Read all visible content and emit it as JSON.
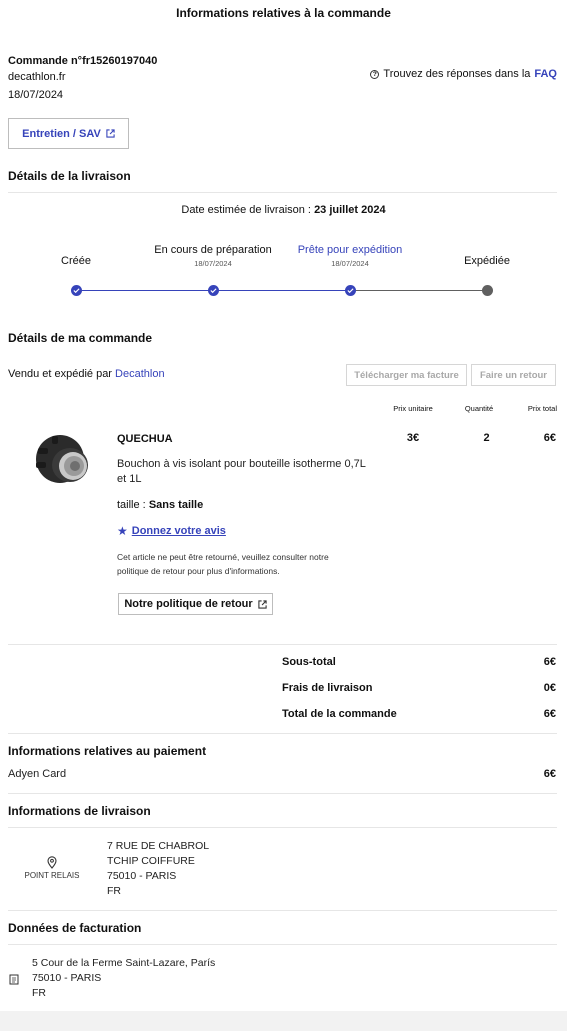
{
  "page": {
    "title": "Informations relatives à la commande"
  },
  "order": {
    "number_label": "Commande n°fr15260197040",
    "site": "decathlon.fr",
    "date": "18/07/2024"
  },
  "faq": {
    "prefix": "Trouvez des réponses dans la",
    "link": "FAQ"
  },
  "service_button": "Entretien / SAV",
  "delivery": {
    "heading": "Détails de la livraison",
    "estimate_prefix": "Date estimée de livraison :",
    "estimate_date": "23 juillet 2024",
    "steps": [
      {
        "label": "Créée",
        "date": "",
        "status": "done"
      },
      {
        "label": "En cours de préparation",
        "date": "18/07/2024",
        "status": "done"
      },
      {
        "label": "Prête pour expédition",
        "date": "18/07/2024",
        "status": "current"
      },
      {
        "label": "Expédiée",
        "date": "",
        "status": "todo"
      }
    ]
  },
  "order_details": {
    "heading": "Détails de ma commande",
    "sold_by_prefix": "Vendu et expédié par",
    "seller": "Decathlon",
    "invoice_button": "Télécharger ma facture",
    "return_button": "Faire un retour",
    "columns": {
      "unit_price": "Prix unitaire",
      "quantity": "Quantité",
      "total_price": "Prix total"
    }
  },
  "product": {
    "brand": "QUECHUA",
    "description": "Bouchon à vis isolant pour bouteille isotherme 0,7L et 1L",
    "size_label": "taille :",
    "size_value": "Sans taille",
    "review_link": "Donnez votre avis",
    "return_notice": "Cet article ne peut être retourné, veuillez consulter notre politique de retour pour plus d'informations.",
    "return_policy_button": "Notre politique de retour",
    "unit_price": "3€",
    "quantity": "2",
    "total_price": "6€"
  },
  "totals": {
    "subtotal_label": "Sous-total",
    "subtotal": "6€",
    "shipping_label": "Frais de livraison",
    "shipping": "0€",
    "total_label": "Total de la commande",
    "total": "6€"
  },
  "payment": {
    "heading": "Informations relatives au paiement",
    "method": "Adyen Card",
    "amount": "6€"
  },
  "shipping_info": {
    "heading": "Informations de livraison",
    "type_label": "POINT RELAIS",
    "lines": [
      "7 RUE DE CHABROL",
      "TCHIP COIFFURE",
      "75010 - PARIS",
      "FR"
    ]
  },
  "billing": {
    "heading": "Données de facturation",
    "lines": [
      "5 Cour de la Ferme Saint-Lazare, París",
      "75010 - PARIS",
      "FR"
    ]
  },
  "colors": {
    "accent": "#3643ba",
    "muted": "#606060"
  }
}
